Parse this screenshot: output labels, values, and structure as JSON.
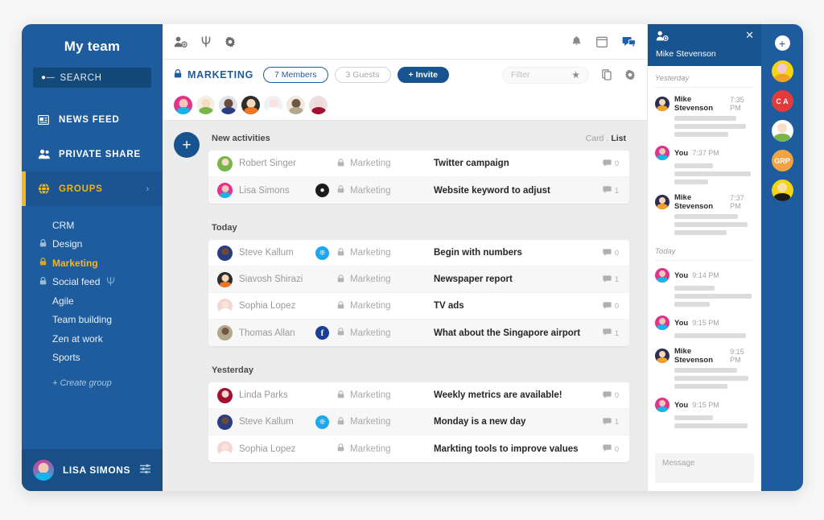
{
  "sidebar": {
    "title": "My team",
    "search": {
      "label": "SEARCH",
      "icon": "search-icon"
    },
    "nav": [
      {
        "label": "NEWS FEED",
        "icon": "newsfeed-icon",
        "active": false
      },
      {
        "label": "PRIVATE SHARE",
        "icon": "users-icon",
        "active": false
      },
      {
        "label": "GROUPS",
        "icon": "globe-icon",
        "active": true,
        "chevron": "›"
      }
    ],
    "groups": [
      {
        "label": "CRM",
        "locked": false,
        "selected": false
      },
      {
        "label": "Design",
        "locked": true,
        "selected": false
      },
      {
        "label": "Marketing",
        "locked": true,
        "selected": true
      },
      {
        "label": "Social feed",
        "locked": true,
        "selected": false,
        "extra_icon": "trident-icon"
      },
      {
        "label": "Agile",
        "locked": false,
        "selected": false
      },
      {
        "label": "Team building",
        "locked": false,
        "selected": false
      },
      {
        "label": "Zen at work",
        "locked": false,
        "selected": false
      },
      {
        "label": "Sports",
        "locked": false,
        "selected": false
      }
    ],
    "create_group": "+ Create group",
    "footer": {
      "user": "LISA SIMONS",
      "settings_icon": "sliders-icon"
    }
  },
  "topbar": {
    "left_icons": [
      "add-person-icon",
      "trident-icon",
      "gear-icon"
    ],
    "right_icons": [
      "bell-icon",
      "calendar-icon",
      "chat-icon"
    ]
  },
  "group_header": {
    "lock_icon": "lock-icon",
    "name": "MARKETING",
    "members_pill": "7 Members",
    "guests_pill": "3 Guests",
    "invite_button": "+ Invite",
    "filter_placeholder": "Filter",
    "star_icon": "star-icon",
    "copy_icon": "copy-icon",
    "gear_icon": "gear-icon",
    "member_avatars": [
      {
        "head": "#f3c7b8",
        "body": "#18b4e8",
        "ring": "#e2338c"
      },
      {
        "head": "#f6ddc0",
        "body": "#79b548",
        "ring": "#f2f0e4"
      },
      {
        "head": "#6b4a3a",
        "body": "#2b3d80",
        "ring": "#dfe2ea"
      },
      {
        "head": "#f6d9bd",
        "body": "#ef7520",
        "ring": "#2d2d2d"
      },
      {
        "head": "#fbe3da",
        "body": "#ffffff",
        "ring": "#edf2f6"
      },
      {
        "head": "#6e5845",
        "body": "#b3a78f",
        "ring": "#efeade"
      },
      {
        "head": "#f2d9d5",
        "body": "#a21230",
        "ring": "#eedfe2"
      }
    ]
  },
  "content": {
    "add_button": "+",
    "view_card": "Card",
    "view_list": "List",
    "sections": [
      {
        "title": "New activities",
        "show_toggle": true,
        "rows": [
          {
            "user": "Robert Singer",
            "group": "Marketing",
            "title": "Twitter campaign",
            "comments": "0",
            "badge": null,
            "avatar": {
              "head": "#f8ddc9",
              "body": "#79b548"
            }
          },
          {
            "user": "Lisa Simons",
            "group": "Marketing",
            "title": "Website keyword to adjust",
            "comments": "1",
            "badge": "github",
            "avatar": {
              "head": "#f3c7b8",
              "body": "#18b4e8",
              "ring": "#e2338c"
            }
          }
        ]
      },
      {
        "title": "Today",
        "show_toggle": false,
        "rows": [
          {
            "user": "Steve Kallum",
            "group": "Marketing",
            "title": "Begin with numbers",
            "comments": "0",
            "badge": "twitter",
            "avatar": {
              "head": "#6b4a3a",
              "body": "#2b3d80"
            }
          },
          {
            "user": "Siavosh Shirazi",
            "group": "Marketing",
            "title": "Newspaper report",
            "comments": "1",
            "badge": null,
            "avatar": {
              "head": "#f6d9bd",
              "body": "#ef7520",
              "ring": "#2d2d2d"
            }
          },
          {
            "user": "Sophia Lopez",
            "group": "Marketing",
            "title": "TV ads",
            "comments": "0",
            "badge": null,
            "avatar": {
              "head": "#fbe3da",
              "body": "#ffffff",
              "ring": "#f2d7d2"
            }
          },
          {
            "user": "Thomas Allan",
            "group": "Marketing",
            "title": "What about the Singapore airport",
            "comments": "1",
            "badge": "facebook",
            "avatar": {
              "head": "#6e5845",
              "body": "#b3a78f"
            }
          }
        ]
      },
      {
        "title": "Yesterday",
        "show_toggle": false,
        "rows": [
          {
            "user": "Linda Parks",
            "group": "Marketing",
            "title": "Weekly metrics are available!",
            "comments": "0",
            "badge": null,
            "avatar": {
              "head": "#f2d9d5",
              "body": "#a21230"
            }
          },
          {
            "user": "Steve Kallum",
            "group": "Marketing",
            "title": "Monday is a new day",
            "comments": "1",
            "badge": "twitter",
            "avatar": {
              "head": "#6b4a3a",
              "body": "#2b3d80"
            }
          },
          {
            "user": "Sophia Lopez",
            "group": "Marketing",
            "title": "Markting tools to improve values",
            "comments": "0",
            "badge": null,
            "avatar": {
              "head": "#fbe3da",
              "body": "#ffffff",
              "ring": "#f2d7d2"
            }
          }
        ]
      }
    ]
  },
  "chat": {
    "header_icon": "add-person-icon",
    "title": "Mike Stevenson",
    "close_icon": "close-icon",
    "message_placeholder": "Message",
    "threads": [
      {
        "day": "Yesterday",
        "messages": [
          {
            "author": "Mike Stevenson",
            "time": "7:35 PM",
            "lines": [
              78,
              90,
              68
            ],
            "avatar": {
              "head": "#f6d9bd",
              "body": "#f0a12a",
              "ring": "#2b2d52"
            }
          },
          {
            "author": "You",
            "time": "7:37 PM",
            "lines": [
              48,
              96,
              42
            ],
            "avatar": {
              "head": "#f3c7b8",
              "body": "#18b4e8",
              "ring": "#e2338c"
            }
          },
          {
            "author": "Mike Stevenson",
            "time": "7:37 PM",
            "lines": [
              80,
              92,
              66
            ],
            "avatar": {
              "head": "#f6d9bd",
              "body": "#f0a12a",
              "ring": "#2b2d52"
            }
          }
        ]
      },
      {
        "day": "Today",
        "messages": [
          {
            "author": "You",
            "time": "9:14 PM",
            "lines": [
              50,
              97,
              44
            ],
            "avatar": {
              "head": "#f3c7b8",
              "body": "#18b4e8",
              "ring": "#e2338c"
            }
          },
          {
            "author": "You",
            "time": "9:15 PM",
            "lines": [
              90
            ],
            "avatar": {
              "head": "#f3c7b8",
              "body": "#18b4e8",
              "ring": "#e2338c"
            }
          },
          {
            "author": "Mike Stevenson",
            "time": "9:15 PM",
            "lines": [
              79,
              93,
              67
            ],
            "avatar": {
              "head": "#f6d9bd",
              "body": "#f0a12a",
              "ring": "#2b2d52"
            }
          },
          {
            "author": "You",
            "time": "9:15 PM",
            "lines": [
              48,
              92
            ],
            "avatar": {
              "head": "#f3c7b8",
              "body": "#18b4e8",
              "ring": "#e2338c"
            }
          }
        ]
      }
    ]
  },
  "rail": {
    "add_label": "+",
    "items": [
      {
        "type": "avatar",
        "head": "#f2c8d8",
        "body": "#f0a12a",
        "ring": "#f5d512"
      },
      {
        "type": "text",
        "label": "C A",
        "bg": "#e23b3b"
      },
      {
        "type": "avatar",
        "head": "#f8ddc9",
        "body": "#79b548",
        "ring": "#ffffff"
      },
      {
        "type": "text",
        "label": "GRP",
        "bg": "#f0a340"
      },
      {
        "type": "avatar",
        "head": "#f6e0a8",
        "body": "#1b1b1b",
        "ring": "#f5d512"
      }
    ]
  },
  "colors": {
    "brand_blue": "#1e5c9e",
    "deep_blue": "#16538f",
    "accent_yellow": "#f5b820",
    "page_bg": "#ececec"
  }
}
